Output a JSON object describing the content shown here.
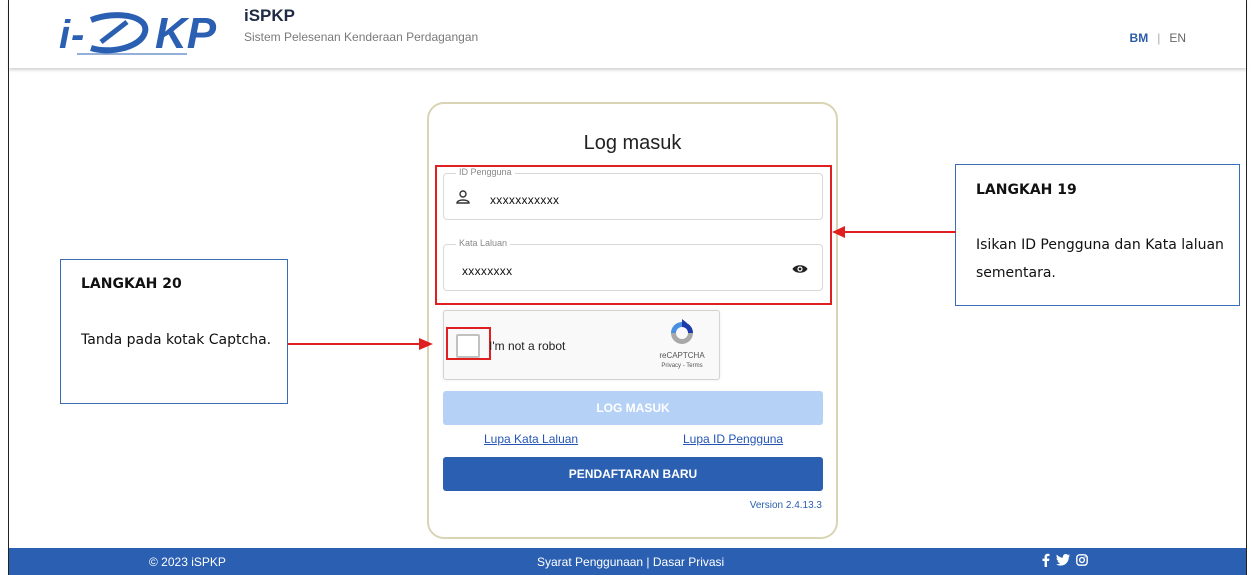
{
  "header": {
    "logo_text": "iSPKP",
    "title": "iSPKP",
    "subtitle": "Sistem Pelesenan Kenderaan Perdagangan",
    "lang_bm": "BM",
    "lang_sep": "|",
    "lang_en": "EN"
  },
  "login": {
    "title": "Log masuk",
    "user_id_label": "ID Pengguna",
    "user_id_value": "xxxxxxxxxxx",
    "password_label": "Kata Laluan",
    "password_value": "xxxxxxxx",
    "captcha_text": "I'm not a robot",
    "captcha_brand": "reCAPTCHA",
    "captcha_links": "Privacy - Terms",
    "login_button": "LOG MASUK",
    "forgot_password": "Lupa Kata Laluan",
    "forgot_id": "Lupa ID Pengguna",
    "register_button": "PENDAFTARAN BARU",
    "version": "Version 2.4.13.3"
  },
  "annotations": {
    "step19_title": "LANGKAH 19",
    "step19_body": "Isikan ID Pengguna dan Kata laluan sementara.",
    "step20_title": "LANGKAH 20",
    "step20_body": "Tanda pada kotak Captcha."
  },
  "footer": {
    "copyright": "© 2023 iSPKP",
    "links": "Syarat Penggunaan | Dasar Privasi"
  },
  "icons": {
    "user": "user-icon",
    "eye": "eye-icon",
    "recaptcha": "recaptcha-icon",
    "facebook": "facebook-icon",
    "twitter": "twitter-icon",
    "instagram": "instagram-icon"
  },
  "colors": {
    "primary": "#2a5fb1",
    "login_disabled": "#b5d1f6",
    "highlight": "#e02020",
    "annotation_border": "#3a6eb5"
  }
}
